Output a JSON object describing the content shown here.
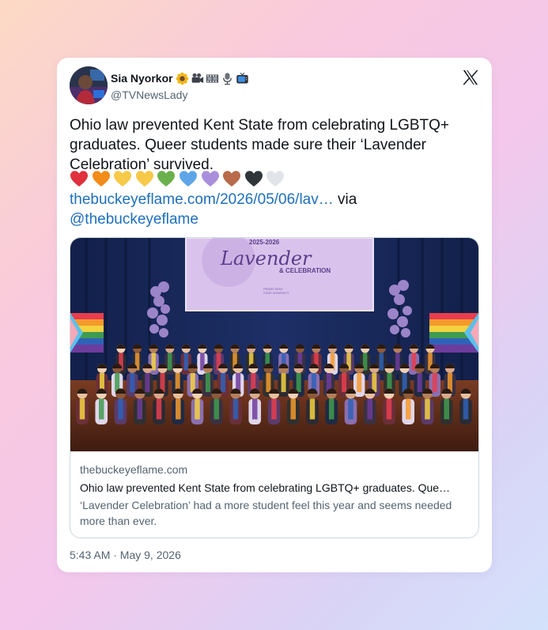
{
  "tweet": {
    "author": {
      "name": "Sia Nyorkor",
      "handle": "@TVNewsLady",
      "name_badges": [
        "sunflower-icon",
        "movie-camera-icon",
        "film-strip-icon",
        "microphone-icon",
        "television-icon"
      ]
    },
    "platform_icon": "x-logo-icon",
    "text_lines": [
      "Ohio law prevented Kent State from celebrating LGBTQ+",
      "graduates. Queer students made sure their ‘Lavender",
      "Celebration’ survived."
    ],
    "hearts": [
      "#e0313f",
      "#f28c1a",
      "#f7c948",
      "#f7c948",
      "#6ab04c",
      "#5ea5e8",
      "#a98fdc",
      "#b86a4a",
      "#30353a",
      "#e1e4e8"
    ],
    "link": {
      "text": "thebuckeyeflame.com/2026/05/06/lav…",
      "via": "via",
      "mention": "@thebuckeyeflame"
    },
    "preview": {
      "screen_text": {
        "year": "2025-2026",
        "title": "Lavender",
        "subtitle": "& CELEBRATION",
        "logo_line1": "PRIDE! KENT",
        "logo_line2": "STATE UNIVERSITY"
      },
      "domain": "thebuckeyeflame.com",
      "title": "Ohio law prevented Kent State from celebrating LGBTQ+ graduates. Que…",
      "description": "‘Lavender Celebration’ had a more student feel this year and seems needed more than ever."
    },
    "timestamp": "5:43 AM · May 9, 2026"
  }
}
